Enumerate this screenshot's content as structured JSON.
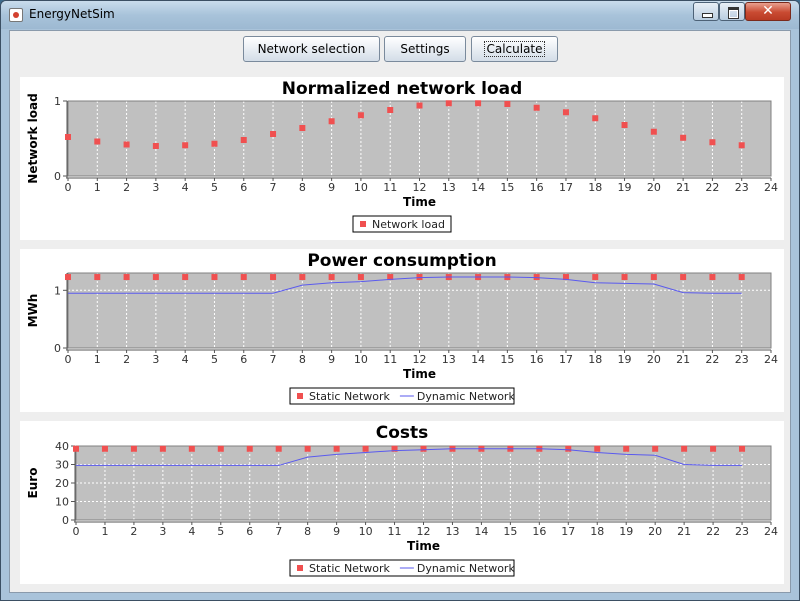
{
  "window": {
    "title": "EnergyNetSim",
    "close_glyph": "✕"
  },
  "toolbar": {
    "buttons": [
      {
        "label": "Network selection"
      },
      {
        "label": "Settings"
      },
      {
        "label": "Calculate"
      }
    ]
  },
  "colors": {
    "plot_bg": "#c0c0c0",
    "static_marker": "#f05050",
    "dynamic_line": "#5a5aee",
    "grid": "#ffffff"
  },
  "chart_data": [
    {
      "type": "scatter",
      "title": "Normalized network load",
      "xlabel": "Time",
      "ylabel": "Network load",
      "xlim": [
        0,
        24
      ],
      "ylim": [
        0,
        1
      ],
      "xticks": [
        0,
        1,
        2,
        3,
        4,
        5,
        6,
        7,
        8,
        9,
        10,
        11,
        12,
        13,
        14,
        15,
        16,
        17,
        18,
        19,
        20,
        21,
        22,
        23,
        24
      ],
      "yticks": [
        0,
        1
      ],
      "grid": true,
      "legend": "bottom",
      "series": [
        {
          "name": "Network load",
          "kind": "marker",
          "x": [
            0,
            1,
            2,
            3,
            4,
            5,
            6,
            7,
            8,
            9,
            10,
            11,
            12,
            13,
            14,
            15,
            16,
            17,
            18,
            19,
            20,
            21,
            22,
            23
          ],
          "y": [
            0.52,
            0.46,
            0.42,
            0.4,
            0.41,
            0.43,
            0.48,
            0.56,
            0.64,
            0.73,
            0.81,
            0.88,
            0.94,
            0.97,
            0.97,
            0.96,
            0.91,
            0.85,
            0.77,
            0.68,
            0.59,
            0.51,
            0.45,
            0.41
          ]
        }
      ]
    },
    {
      "type": "line",
      "title": "Power consumption",
      "xlabel": "Time",
      "ylabel": "MWh",
      "xlim": [
        0,
        24
      ],
      "ylim": [
        0,
        1.3
      ],
      "xticks": [
        0,
        1,
        2,
        3,
        4,
        5,
        6,
        7,
        8,
        9,
        10,
        11,
        12,
        13,
        14,
        15,
        16,
        17,
        18,
        19,
        20,
        21,
        22,
        23,
        24
      ],
      "yticks": [
        0,
        1
      ],
      "grid": true,
      "legend": "bottom",
      "series": [
        {
          "name": "Static Network",
          "kind": "marker",
          "x": [
            0,
            1,
            2,
            3,
            4,
            5,
            6,
            7,
            8,
            9,
            10,
            11,
            12,
            13,
            14,
            15,
            16,
            17,
            18,
            19,
            20,
            21,
            22,
            23
          ],
          "y": [
            1.23,
            1.23,
            1.23,
            1.23,
            1.23,
            1.23,
            1.23,
            1.23,
            1.23,
            1.23,
            1.23,
            1.23,
            1.23,
            1.23,
            1.23,
            1.23,
            1.23,
            1.23,
            1.23,
            1.23,
            1.23,
            1.23,
            1.23,
            1.23
          ]
        },
        {
          "name": "Dynamic Network",
          "kind": "line",
          "x": [
            0,
            1,
            2,
            3,
            4,
            5,
            6,
            7,
            8,
            9,
            10,
            11,
            12,
            13,
            14,
            15,
            16,
            17,
            18,
            19,
            20,
            21,
            22,
            23
          ],
          "y": [
            0.95,
            0.95,
            0.95,
            0.95,
            0.95,
            0.95,
            0.95,
            0.95,
            1.09,
            1.13,
            1.15,
            1.19,
            1.22,
            1.23,
            1.23,
            1.23,
            1.22,
            1.19,
            1.13,
            1.12,
            1.11,
            0.96,
            0.95,
            0.95
          ]
        }
      ]
    },
    {
      "type": "line",
      "title": "Costs",
      "xlabel": "Time",
      "ylabel": "Euro",
      "xlim": [
        0,
        24
      ],
      "ylim": [
        0,
        40
      ],
      "xticks": [
        0,
        1,
        2,
        3,
        4,
        5,
        6,
        7,
        8,
        9,
        10,
        11,
        12,
        13,
        14,
        15,
        16,
        17,
        18,
        19,
        20,
        21,
        22,
        23,
        24
      ],
      "yticks": [
        0,
        10,
        20,
        30,
        40
      ],
      "grid": true,
      "legend": "bottom",
      "series": [
        {
          "name": "Static Network",
          "kind": "marker",
          "x": [
            0,
            1,
            2,
            3,
            4,
            5,
            6,
            7,
            8,
            9,
            10,
            11,
            12,
            13,
            14,
            15,
            16,
            17,
            18,
            19,
            20,
            21,
            22,
            23
          ],
          "y": [
            38.5,
            38.5,
            38.5,
            38.5,
            38.5,
            38.5,
            38.5,
            38.5,
            38.5,
            38.5,
            38.5,
            38.5,
            38.5,
            38.5,
            38.5,
            38.5,
            38.5,
            38.5,
            38.5,
            38.5,
            38.5,
            38.5,
            38.5,
            38.5
          ]
        },
        {
          "name": "Dynamic Network",
          "kind": "line",
          "x": [
            0,
            1,
            2,
            3,
            4,
            5,
            6,
            7,
            8,
            9,
            10,
            11,
            12,
            13,
            14,
            15,
            16,
            17,
            18,
            19,
            20,
            21,
            22,
            23
          ],
          "y": [
            29.5,
            29.5,
            29.5,
            29.5,
            29.5,
            29.5,
            29.5,
            29.5,
            34,
            35.5,
            36.5,
            37.5,
            38,
            38.5,
            38.5,
            38.5,
            38.5,
            38,
            36.5,
            35.5,
            35,
            30,
            29.5,
            29.5
          ]
        }
      ]
    }
  ]
}
